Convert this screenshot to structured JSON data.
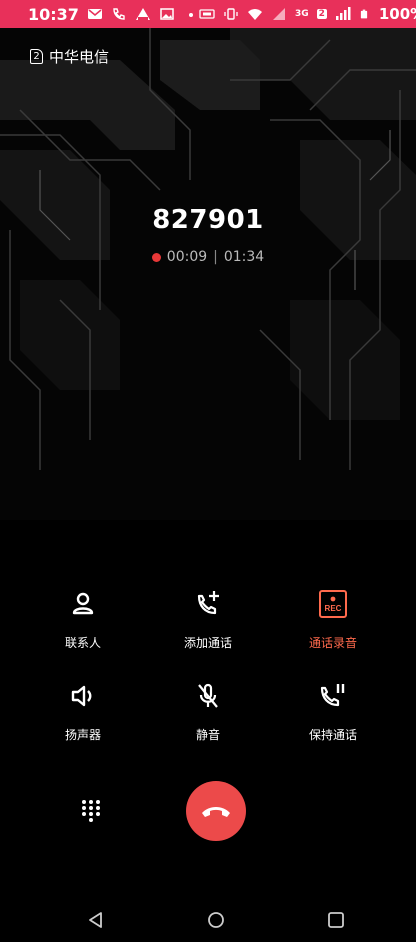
{
  "status_bar": {
    "time": "10:37",
    "battery": "100%",
    "network_type": "3G",
    "sim_slot": "2",
    "color": "#e8305a"
  },
  "carrier": {
    "sim_number": "2",
    "name": "中华电信"
  },
  "call": {
    "number": "827901",
    "recording_time": "00:09",
    "separator": "|",
    "call_duration": "01:34"
  },
  "actions": {
    "contacts": "联系人",
    "add_call": "添加通话",
    "record": "通话录音",
    "record_icon_text": "REC",
    "speaker": "扬声器",
    "mute": "静音",
    "hold": "保持通话"
  },
  "colors": {
    "accent": "#ff6a4d",
    "end_call": "#ec4a4a"
  }
}
